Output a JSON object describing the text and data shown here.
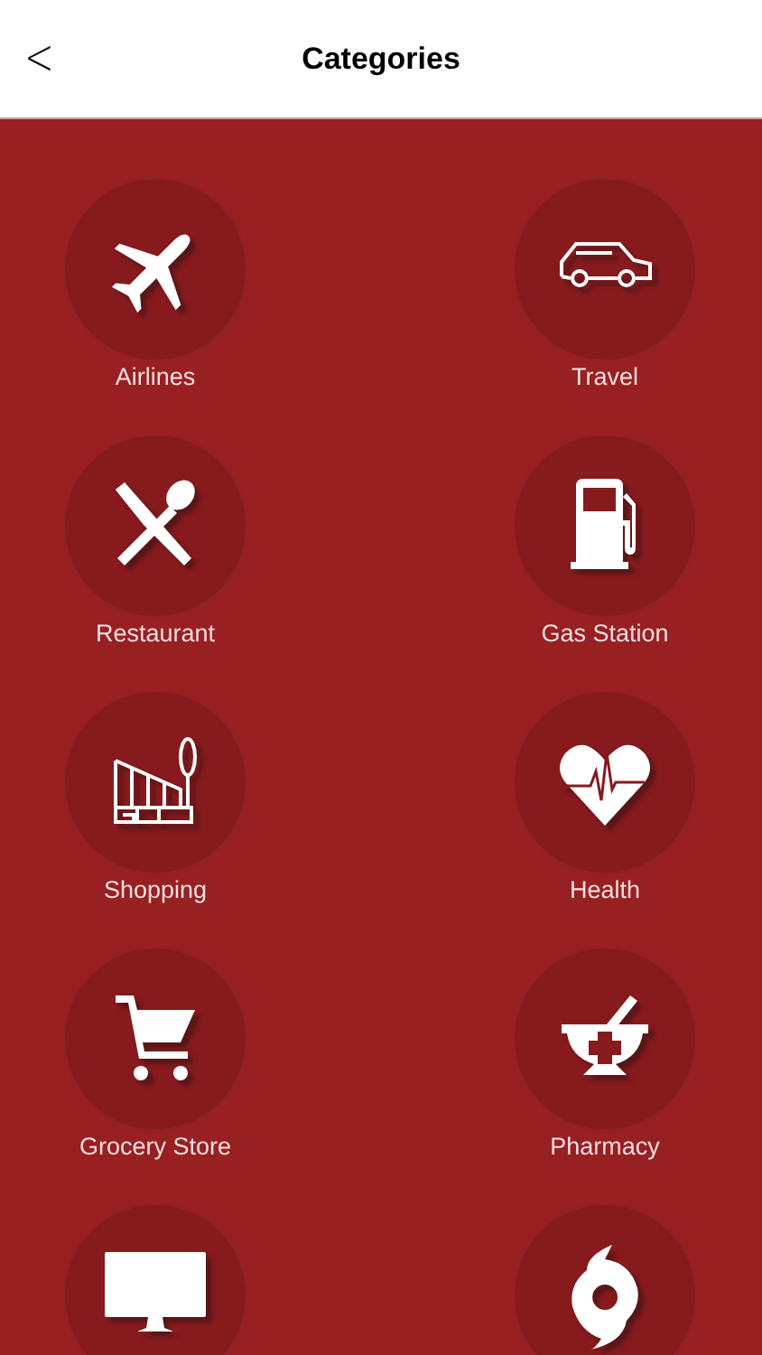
{
  "header": {
    "back": "<",
    "title": "Categories"
  },
  "categories": [
    {
      "kind": "airplane",
      "label": "Airlines"
    },
    {
      "kind": "car",
      "label": "Travel"
    },
    {
      "kind": "utensils",
      "label": "Restaurant"
    },
    {
      "kind": "fuel",
      "label": "Gas Station"
    },
    {
      "kind": "store",
      "label": "Shopping"
    },
    {
      "kind": "heart",
      "label": "Health"
    },
    {
      "kind": "cart",
      "label": "Grocery Store"
    },
    {
      "kind": "mortar",
      "label": "Pharmacy"
    },
    {
      "kind": "monitor"
    },
    {
      "kind": "hurricane"
    }
  ]
}
